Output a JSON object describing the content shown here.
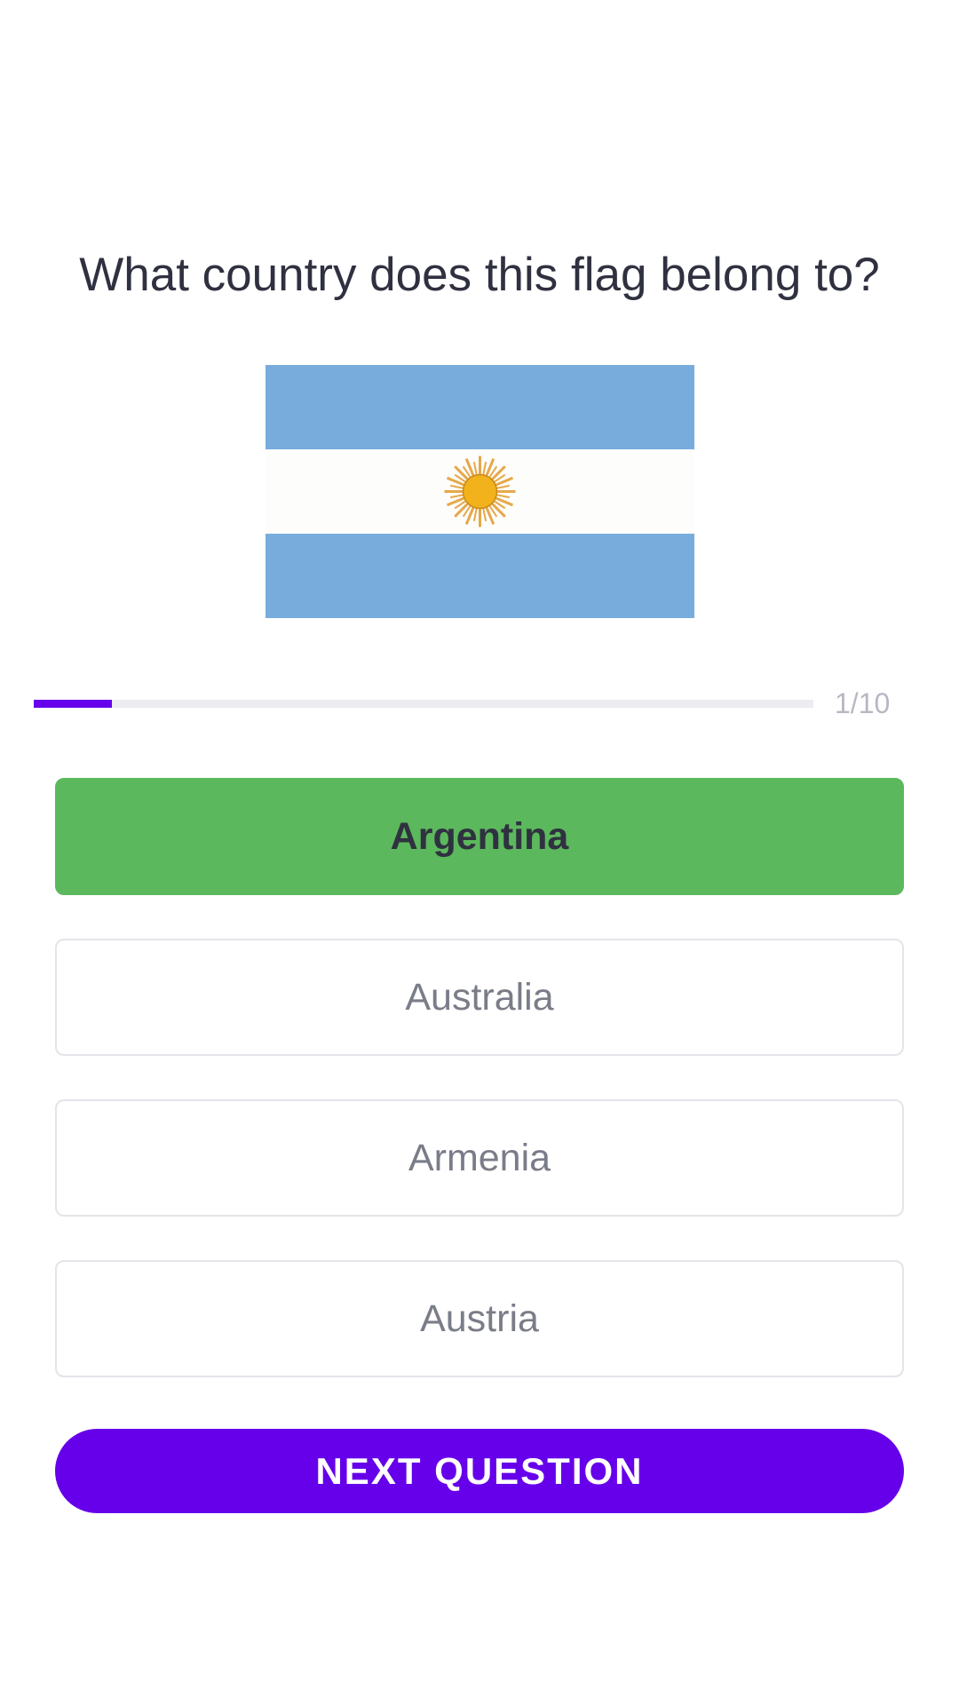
{
  "quiz": {
    "question": "What country does this flag belong to?",
    "flag": {
      "country": "Argentina",
      "stripe_color": "#78acdc",
      "middle_color": "#fdfdfb",
      "sun_color": "#f2b21b",
      "sun_rays_color": "#e6a84a"
    },
    "progress": {
      "label": "1/10",
      "fraction": 0.1,
      "color": "#6600ea"
    },
    "options": [
      {
        "label": "Argentina",
        "state": "correct"
      },
      {
        "label": "Australia",
        "state": "default"
      },
      {
        "label": "Armenia",
        "state": "default"
      },
      {
        "label": "Austria",
        "state": "default"
      }
    ],
    "correct_color": "#5cb85c",
    "next_button": {
      "label": "NEXT QUESTION",
      "background": "#6600ea",
      "text_color": "#ffffff"
    }
  }
}
